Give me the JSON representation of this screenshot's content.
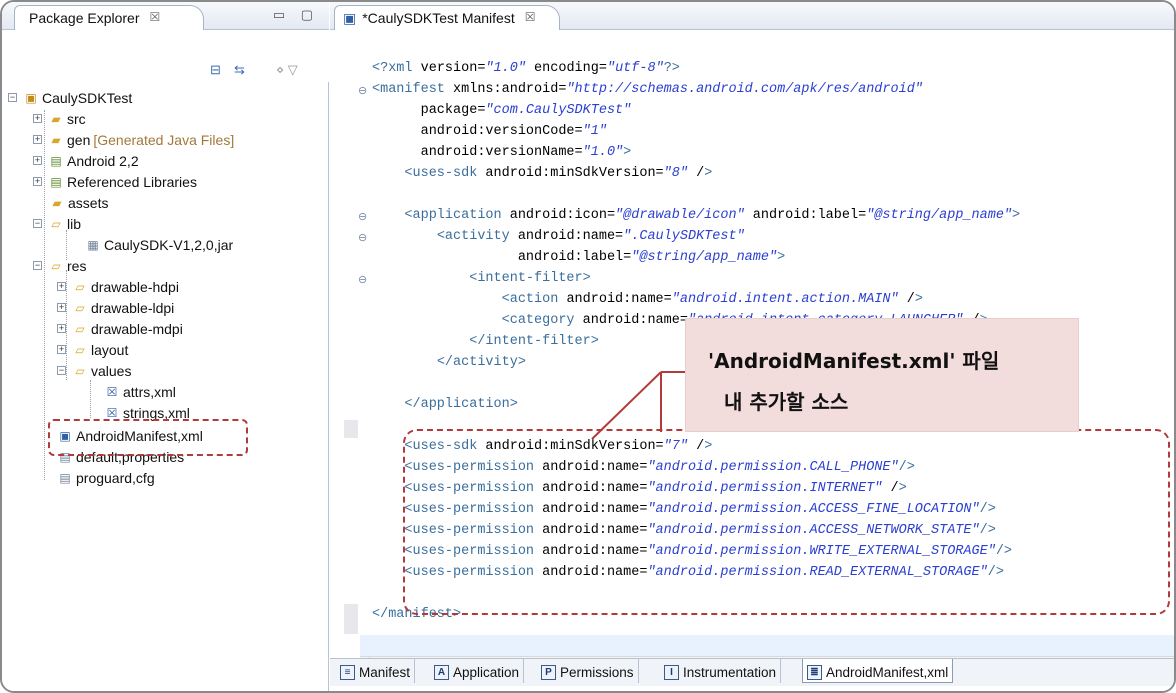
{
  "explorer": {
    "tab_label": "Package Explorer",
    "tab_close": "☒",
    "window_buttons": "▭ ▢",
    "tree": [
      {
        "label": "CaulySDKTest",
        "suffix": ""
      },
      {
        "label": "src",
        "suffix": ""
      },
      {
        "label": "gen",
        "suffix": "[Generated Java Files]"
      },
      {
        "label": "Android 2,2",
        "suffix": ""
      },
      {
        "label": "Referenced Libraries",
        "suffix": ""
      },
      {
        "label": "assets",
        "suffix": ""
      },
      {
        "label": "lib",
        "suffix": ""
      },
      {
        "label": "CaulySDK-V1,2,0,jar",
        "suffix": ""
      },
      {
        "label": "res",
        "suffix": ""
      },
      {
        "label": "drawable-hdpi",
        "suffix": ""
      },
      {
        "label": "drawable-ldpi",
        "suffix": ""
      },
      {
        "label": "drawable-mdpi",
        "suffix": ""
      },
      {
        "label": "layout",
        "suffix": ""
      },
      {
        "label": "values",
        "suffix": ""
      },
      {
        "label": "attrs,xml",
        "suffix": ""
      },
      {
        "label": "strings,xml",
        "suffix": ""
      },
      {
        "label": "AndroidManifest,xml",
        "suffix": ""
      },
      {
        "label": "default,properties",
        "suffix": ""
      },
      {
        "label": "proguard,cfg",
        "suffix": ""
      }
    ]
  },
  "editor": {
    "tab_label": "*CaulySDKTest Manifest",
    "tab_close": "☒",
    "code": [
      "<?xml version=\"1.0\" encoding=\"utf-8\"?>",
      "<manifest xmlns:android=\"http://schemas.android.com/apk/res/android\"",
      "      package=\"com.CaulySDKTest\"",
      "      android:versionCode=\"1\"",
      "      android:versionName=\"1.0\">",
      "    <uses-sdk android:minSdkVersion=\"8\" />",
      "",
      "    <application android:icon=\"@drawable/icon\" android:label=\"@string/app_name\">",
      "        <activity android:name=\".CaulySDKTest\"",
      "                  android:label=\"@string/app_name\">",
      "            <intent-filter>",
      "                <action android:name=\"android.intent.action.MAIN\" />",
      "                <category android:name=\"android.intent.category.LAUNCHER\" />",
      "            </intent-filter>",
      "        </activity>",
      "",
      "    </application>",
      "",
      "    <uses-sdk android:minSdkVersion=\"7\" />",
      "    <uses-permission android:name=\"android.permission.CALL_PHONE\"/>",
      "    <uses-permission android:name=\"android.permission.INTERNET\" />",
      "    <uses-permission android:name=\"android.permission.ACCESS_FINE_LOCATION\"/>",
      "    <uses-permission android:name=\"android.permission.ACCESS_NETWORK_STATE\"/>",
      "    <uses-permission android:name=\"android.permission.WRITE_EXTERNAL_STORAGE\"/>",
      "    <uses-permission android:name=\"android.permission.READ_EXTERNAL_STORAGE\"/>",
      "",
      "</manifest>"
    ],
    "bottom_tabs": [
      {
        "icon": "≡",
        "label": "Manifest"
      },
      {
        "icon": "A",
        "label": "Application"
      },
      {
        "icon": "P",
        "label": "Permissions"
      },
      {
        "icon": "I",
        "label": "Instrumentation"
      },
      {
        "icon": "≣",
        "label": "AndroidManifest,xml"
      }
    ]
  },
  "callout": {
    "line1": "'AndroidManifest.xml' 파일",
    "line2": "내 추가할 소스"
  },
  "colors": {
    "annotation_red": "#b23a3a",
    "callout_bg": "#f2dcdc",
    "xml_tag": "#3a6e9c",
    "xml_string": "#2b3fd0"
  }
}
